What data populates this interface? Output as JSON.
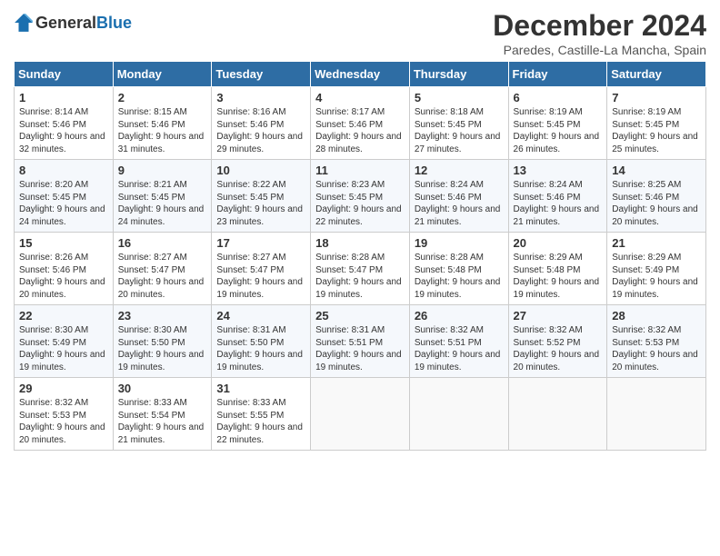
{
  "logo": {
    "general": "General",
    "blue": "Blue"
  },
  "title": "December 2024",
  "location": "Paredes, Castille-La Mancha, Spain",
  "days_of_week": [
    "Sunday",
    "Monday",
    "Tuesday",
    "Wednesday",
    "Thursday",
    "Friday",
    "Saturday"
  ],
  "weeks": [
    [
      {
        "day": "1",
        "sunrise": "Sunrise: 8:14 AM",
        "sunset": "Sunset: 5:46 PM",
        "daylight": "Daylight: 9 hours and 32 minutes."
      },
      {
        "day": "2",
        "sunrise": "Sunrise: 8:15 AM",
        "sunset": "Sunset: 5:46 PM",
        "daylight": "Daylight: 9 hours and 31 minutes."
      },
      {
        "day": "3",
        "sunrise": "Sunrise: 8:16 AM",
        "sunset": "Sunset: 5:46 PM",
        "daylight": "Daylight: 9 hours and 29 minutes."
      },
      {
        "day": "4",
        "sunrise": "Sunrise: 8:17 AM",
        "sunset": "Sunset: 5:46 PM",
        "daylight": "Daylight: 9 hours and 28 minutes."
      },
      {
        "day": "5",
        "sunrise": "Sunrise: 8:18 AM",
        "sunset": "Sunset: 5:45 PM",
        "daylight": "Daylight: 9 hours and 27 minutes."
      },
      {
        "day": "6",
        "sunrise": "Sunrise: 8:19 AM",
        "sunset": "Sunset: 5:45 PM",
        "daylight": "Daylight: 9 hours and 26 minutes."
      },
      {
        "day": "7",
        "sunrise": "Sunrise: 8:19 AM",
        "sunset": "Sunset: 5:45 PM",
        "daylight": "Daylight: 9 hours and 25 minutes."
      }
    ],
    [
      {
        "day": "8",
        "sunrise": "Sunrise: 8:20 AM",
        "sunset": "Sunset: 5:45 PM",
        "daylight": "Daylight: 9 hours and 24 minutes."
      },
      {
        "day": "9",
        "sunrise": "Sunrise: 8:21 AM",
        "sunset": "Sunset: 5:45 PM",
        "daylight": "Daylight: 9 hours and 24 minutes."
      },
      {
        "day": "10",
        "sunrise": "Sunrise: 8:22 AM",
        "sunset": "Sunset: 5:45 PM",
        "daylight": "Daylight: 9 hours and 23 minutes."
      },
      {
        "day": "11",
        "sunrise": "Sunrise: 8:23 AM",
        "sunset": "Sunset: 5:45 PM",
        "daylight": "Daylight: 9 hours and 22 minutes."
      },
      {
        "day": "12",
        "sunrise": "Sunrise: 8:24 AM",
        "sunset": "Sunset: 5:46 PM",
        "daylight": "Daylight: 9 hours and 21 minutes."
      },
      {
        "day": "13",
        "sunrise": "Sunrise: 8:24 AM",
        "sunset": "Sunset: 5:46 PM",
        "daylight": "Daylight: 9 hours and 21 minutes."
      },
      {
        "day": "14",
        "sunrise": "Sunrise: 8:25 AM",
        "sunset": "Sunset: 5:46 PM",
        "daylight": "Daylight: 9 hours and 20 minutes."
      }
    ],
    [
      {
        "day": "15",
        "sunrise": "Sunrise: 8:26 AM",
        "sunset": "Sunset: 5:46 PM",
        "daylight": "Daylight: 9 hours and 20 minutes."
      },
      {
        "day": "16",
        "sunrise": "Sunrise: 8:27 AM",
        "sunset": "Sunset: 5:47 PM",
        "daylight": "Daylight: 9 hours and 20 minutes."
      },
      {
        "day": "17",
        "sunrise": "Sunrise: 8:27 AM",
        "sunset": "Sunset: 5:47 PM",
        "daylight": "Daylight: 9 hours and 19 minutes."
      },
      {
        "day": "18",
        "sunrise": "Sunrise: 8:28 AM",
        "sunset": "Sunset: 5:47 PM",
        "daylight": "Daylight: 9 hours and 19 minutes."
      },
      {
        "day": "19",
        "sunrise": "Sunrise: 8:28 AM",
        "sunset": "Sunset: 5:48 PM",
        "daylight": "Daylight: 9 hours and 19 minutes."
      },
      {
        "day": "20",
        "sunrise": "Sunrise: 8:29 AM",
        "sunset": "Sunset: 5:48 PM",
        "daylight": "Daylight: 9 hours and 19 minutes."
      },
      {
        "day": "21",
        "sunrise": "Sunrise: 8:29 AM",
        "sunset": "Sunset: 5:49 PM",
        "daylight": "Daylight: 9 hours and 19 minutes."
      }
    ],
    [
      {
        "day": "22",
        "sunrise": "Sunrise: 8:30 AM",
        "sunset": "Sunset: 5:49 PM",
        "daylight": "Daylight: 9 hours and 19 minutes."
      },
      {
        "day": "23",
        "sunrise": "Sunrise: 8:30 AM",
        "sunset": "Sunset: 5:50 PM",
        "daylight": "Daylight: 9 hours and 19 minutes."
      },
      {
        "day": "24",
        "sunrise": "Sunrise: 8:31 AM",
        "sunset": "Sunset: 5:50 PM",
        "daylight": "Daylight: 9 hours and 19 minutes."
      },
      {
        "day": "25",
        "sunrise": "Sunrise: 8:31 AM",
        "sunset": "Sunset: 5:51 PM",
        "daylight": "Daylight: 9 hours and 19 minutes."
      },
      {
        "day": "26",
        "sunrise": "Sunrise: 8:32 AM",
        "sunset": "Sunset: 5:51 PM",
        "daylight": "Daylight: 9 hours and 19 minutes."
      },
      {
        "day": "27",
        "sunrise": "Sunrise: 8:32 AM",
        "sunset": "Sunset: 5:52 PM",
        "daylight": "Daylight: 9 hours and 20 minutes."
      },
      {
        "day": "28",
        "sunrise": "Sunrise: 8:32 AM",
        "sunset": "Sunset: 5:53 PM",
        "daylight": "Daylight: 9 hours and 20 minutes."
      }
    ],
    [
      {
        "day": "29",
        "sunrise": "Sunrise: 8:32 AM",
        "sunset": "Sunset: 5:53 PM",
        "daylight": "Daylight: 9 hours and 20 minutes."
      },
      {
        "day": "30",
        "sunrise": "Sunrise: 8:33 AM",
        "sunset": "Sunset: 5:54 PM",
        "daylight": "Daylight: 9 hours and 21 minutes."
      },
      {
        "day": "31",
        "sunrise": "Sunrise: 8:33 AM",
        "sunset": "Sunset: 5:55 PM",
        "daylight": "Daylight: 9 hours and 22 minutes."
      },
      null,
      null,
      null,
      null
    ]
  ]
}
